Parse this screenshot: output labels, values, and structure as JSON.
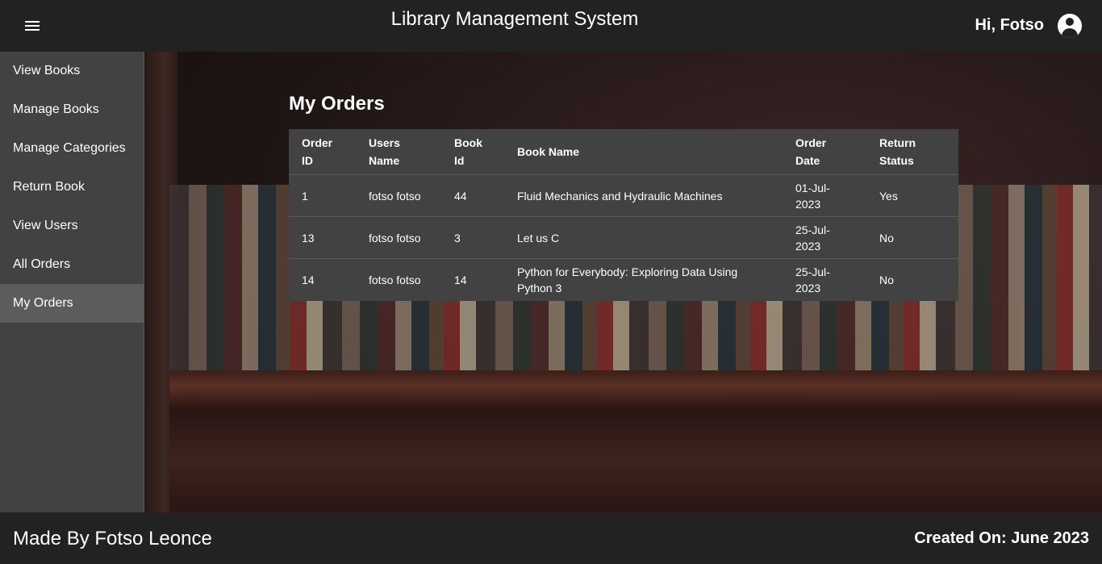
{
  "header": {
    "title": "Library Management System",
    "greeting": "Hi, Fotso",
    "menu_icon": "menu-icon",
    "account_icon": "account-circle-icon"
  },
  "sidebar": {
    "items": [
      {
        "label": "View Books"
      },
      {
        "label": "Manage Books"
      },
      {
        "label": "Manage Categories"
      },
      {
        "label": "Return Book"
      },
      {
        "label": "View Users"
      },
      {
        "label": "All Orders"
      },
      {
        "label": "My Orders",
        "active": true
      }
    ]
  },
  "main": {
    "heading": "My Orders",
    "table": {
      "headers": [
        "Order ID",
        "Users Name",
        "Book Id",
        "Book Name",
        "Order Date",
        "Return Status"
      ],
      "rows": [
        [
          "1",
          "fotso fotso",
          "44",
          "Fluid Mechanics and Hydraulic Machines",
          "01-Jul-2023",
          "Yes"
        ],
        [
          "13",
          "fotso fotso",
          "3",
          "Let us C",
          "25-Jul-2023",
          "No"
        ],
        [
          "14",
          "fotso fotso",
          "14",
          "Python for Everybody: Exploring Data Using Python 3",
          "25-Jul-2023",
          "No"
        ]
      ]
    }
  },
  "footer": {
    "made_by": "Made By Fotso Leonce",
    "created_on": "Created On: June 2023"
  },
  "colors": {
    "topbar": "#222222",
    "sidebar": "#424242",
    "sidebar_active": "#5c5c5c",
    "table_bg": "#424242"
  }
}
